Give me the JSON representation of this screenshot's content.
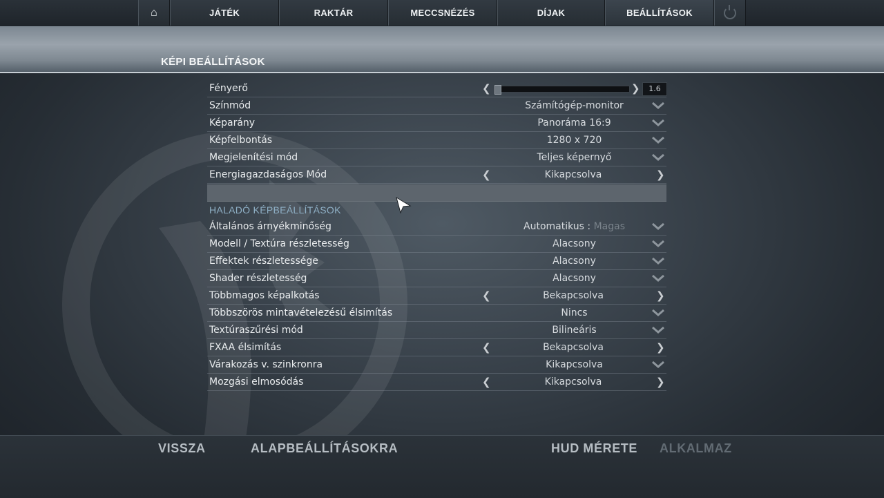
{
  "nav": {
    "items": [
      "JÁTÉK",
      "RAKTÁR",
      "MECCSNÉZÉS",
      "DÍJAK",
      "BEÁLLÍTÁSOK"
    ]
  },
  "header": {
    "title": "KÉPI BEÁLLÍTÁSOK"
  },
  "brightness": {
    "label": "Fényerő",
    "value": "1.6",
    "level_fraction": 0.0
  },
  "basic_settings": [
    {
      "label": "Színmód",
      "value": "Számítógép-monitor"
    },
    {
      "label": "Képarány",
      "value": "Panoráma 16:9"
    },
    {
      "label": "Képfelbontás",
      "value": "1280 x 720"
    },
    {
      "label": "Megjelenítési mód",
      "value": "Teljes képernyő"
    },
    {
      "label": "Energiagazdaságos Mód",
      "value": "Kikapcsolva"
    }
  ],
  "advanced": {
    "title": "HALADÓ KÉPBEÁLLÍTÁSOK",
    "shadow": {
      "label": "Általános árnyékminőség",
      "value_prefix": "Automatikus :",
      "value_dim": "Magas"
    },
    "rows": [
      {
        "label": "Modell / Textúra részletesség",
        "value": "Alacsony"
      },
      {
        "label": "Effektek részletessége",
        "value": "Alacsony"
      },
      {
        "label": "Shader részletesség",
        "value": "Alacsony"
      },
      {
        "label": "Többmagos képalkotás",
        "value": "Bekapcsolva"
      },
      {
        "label": "Többszörös mintavételezésű élsimítás",
        "value": "Nincs"
      },
      {
        "label": "Textúraszűrési mód",
        "value": "Bilineáris"
      },
      {
        "label": "FXAA élsimítás",
        "value": "Bekapcsolva"
      },
      {
        "label": "Várakozás v. szinkronra",
        "value": "Kikapcsolva"
      },
      {
        "label": "Mozgási elmosódás",
        "value": "Kikapcsolva"
      }
    ]
  },
  "bottom": {
    "back": "VISSZA",
    "defaults": "ALAPBEÁLLÍTÁSOKRA",
    "hud_size": "HUD MÉRETE",
    "apply": "ALKALMAZ"
  }
}
